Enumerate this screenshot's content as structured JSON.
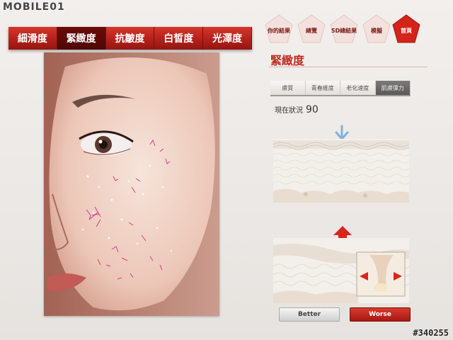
{
  "watermark": {
    "logo_text": "MOBILE01",
    "photo_id": "#340255"
  },
  "metric_tabs": [
    {
      "label": "細滑度",
      "active": false
    },
    {
      "label": "緊緻度",
      "active": true
    },
    {
      "label": "抗皺度",
      "active": false
    },
    {
      "label": "白皙度",
      "active": false
    },
    {
      "label": "光澤度",
      "active": false
    }
  ],
  "nav": {
    "items": [
      {
        "label": "你的結果"
      },
      {
        "label": "總覽"
      },
      {
        "label": "5D總結果"
      },
      {
        "label": "模擬"
      },
      {
        "label": "首頁"
      }
    ]
  },
  "section": {
    "title": "緊緻度",
    "subtabs": [
      {
        "label": "膚質",
        "active": false
      },
      {
        "label": "青春維度",
        "active": false
      },
      {
        "label": "老化速度",
        "active": false
      },
      {
        "label": "肌膚彈力",
        "active": true
      }
    ],
    "status_label": "現在狀況",
    "status_value": "90"
  },
  "buttons": {
    "better": "Better",
    "worse": "Worse"
  },
  "colors": {
    "accent_red": "#c22b21",
    "tab_active": "#5a0a07",
    "home_pent": "#d2241a"
  },
  "icons": {
    "up_arrow": "red-up-arrow-icon",
    "down_arrow": "blue-down-arrow-icon"
  }
}
